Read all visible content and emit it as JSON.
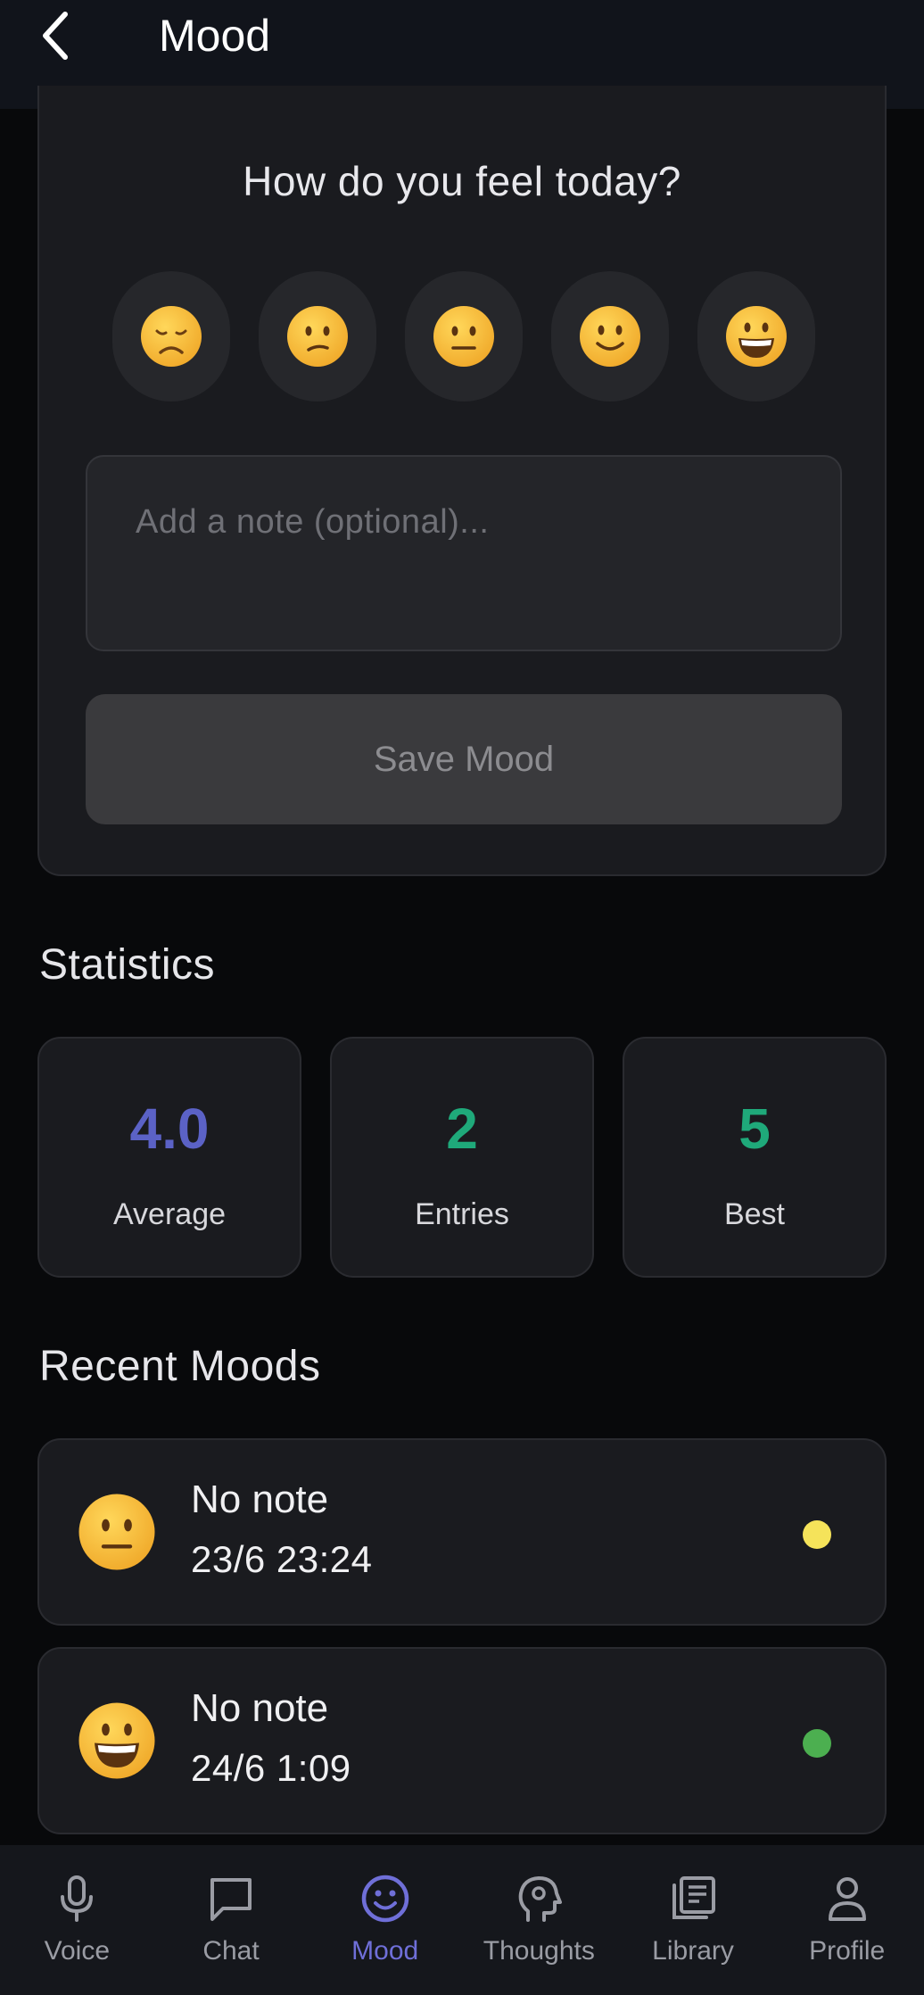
{
  "header": {
    "title": "Mood"
  },
  "mood_form": {
    "question": "How do you feel today?",
    "emojis": [
      {
        "icon": "sad-face-icon",
        "level": 1
      },
      {
        "icon": "confused-face-icon",
        "level": 2
      },
      {
        "icon": "neutral-face-icon",
        "level": 3
      },
      {
        "icon": "slight-smile-face-icon",
        "level": 4
      },
      {
        "icon": "grin-face-icon",
        "level": 5
      }
    ],
    "note_placeholder": "Add a note (optional)...",
    "save_label": "Save Mood"
  },
  "statistics": {
    "title": "Statistics",
    "average": {
      "value": "4.0",
      "label": "Average",
      "color": "#5b62c6"
    },
    "entries": {
      "value": "2",
      "label": "Entries",
      "color": "#1fa97a"
    },
    "best": {
      "value": "5",
      "label": "Best",
      "color": "#1fa97a"
    }
  },
  "recent": {
    "title": "Recent Moods",
    "items": [
      {
        "icon": "neutral-face-icon",
        "note": "No note",
        "time": "23/6 23:24",
        "dot_color": "#f5e35a"
      },
      {
        "icon": "grin-face-icon",
        "note": "No note",
        "time": "24/6 1:09",
        "dot_color": "#4caf50"
      }
    ]
  },
  "nav": {
    "items": [
      {
        "label": "Voice",
        "icon": "microphone-icon"
      },
      {
        "label": "Chat",
        "icon": "chat-bubble-icon"
      },
      {
        "label": "Mood",
        "icon": "smiley-icon",
        "active": true
      },
      {
        "label": "Thoughts",
        "icon": "brain-head-icon"
      },
      {
        "label": "Library",
        "icon": "library-icon"
      },
      {
        "label": "Profile",
        "icon": "person-icon"
      }
    ]
  },
  "colors": {
    "accent": "#6f6fd8",
    "background": "#08090b",
    "card": "#1a1b1f"
  }
}
